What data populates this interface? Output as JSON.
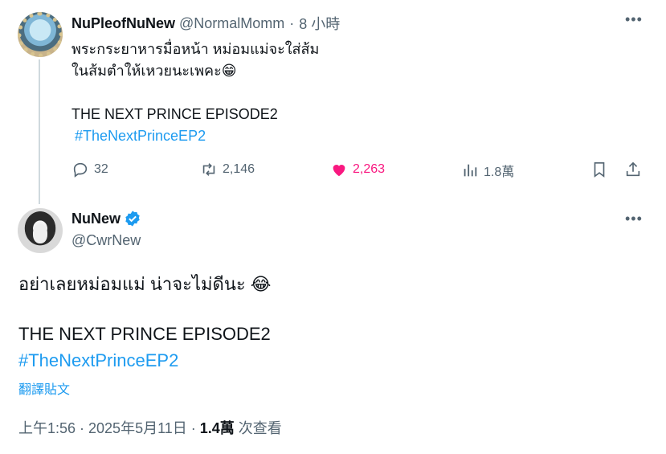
{
  "tweet1": {
    "display_name": "NuPleofNuNew",
    "handle": "@NormalMomm",
    "separator": "·",
    "time": "8 小時",
    "text_lines": [
      "พระกระยาหารมื่อหน้า หม่อมแม่จะใส่ส้ม",
      "ในส้มตำให้เหวยนะเพคะ😁",
      "",
      "THE NEXT PRINCE EPISODE2"
    ],
    "hashtag": "#TheNextPrinceEP2",
    "replies": "32",
    "retweets": "2,146",
    "likes": "2,263",
    "views": "1.8萬",
    "colors": {
      "like": "#f91880",
      "muted": "#536471",
      "link": "#1d9bf0"
    }
  },
  "tweet2": {
    "display_name": "NuNew",
    "handle": "@CwrNew",
    "verified": true,
    "text_line1": "อย่าเลยหม่อมแม่ น่าจะไม่ดีนะ 😂",
    "text_line2": "THE NEXT PRINCE EPISODE2",
    "hashtag": "#TheNextPrinceEP2",
    "translate_label": "翻譯貼文",
    "timestamp": "上午1:56 · 2025年5月11日 · ",
    "views_count": "1.4萬",
    "views_label": " 次查看"
  },
  "icons": [
    "more-icon",
    "reply-icon",
    "retweet-icon",
    "heart-icon",
    "views-icon",
    "bookmark-icon",
    "share-icon",
    "verified-badge-icon"
  ]
}
